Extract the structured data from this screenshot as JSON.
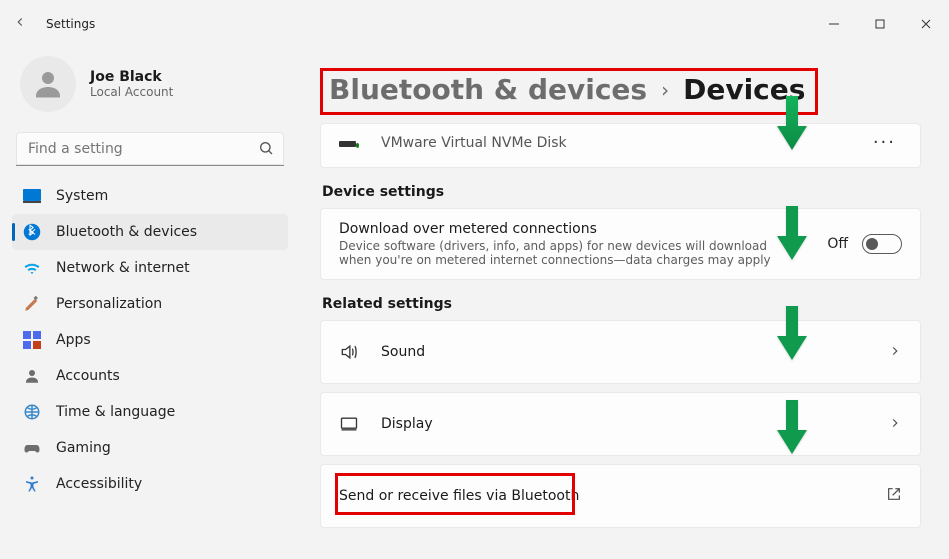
{
  "window": {
    "title": "Settings"
  },
  "user": {
    "name": "Joe Black",
    "sub": "Local Account"
  },
  "search": {
    "placeholder": "Find a setting"
  },
  "sidebar": {
    "items": [
      {
        "label": "System"
      },
      {
        "label": "Bluetooth & devices"
      },
      {
        "label": "Network & internet"
      },
      {
        "label": "Personalization"
      },
      {
        "label": "Apps"
      },
      {
        "label": "Accounts"
      },
      {
        "label": "Time & language"
      },
      {
        "label": "Gaming"
      },
      {
        "label": "Accessibility"
      }
    ],
    "active_index": 1
  },
  "breadcrumb": {
    "parent": "Bluetooth & devices",
    "current": "Devices"
  },
  "devices": {
    "last_item": {
      "label": "VMware Virtual NVMe Disk"
    }
  },
  "device_settings": {
    "heading": "Device settings",
    "metered": {
      "title": "Download over metered connections",
      "sub": "Device software (drivers, info, and apps) for new devices will download when you're on metered internet connections—data charges may apply",
      "toggle_text": "Off",
      "toggle_on": false
    }
  },
  "related": {
    "heading": "Related settings",
    "items": [
      {
        "label": "Sound"
      },
      {
        "label": "Display"
      },
      {
        "label": "Send or receive files via Bluetooth"
      }
    ]
  }
}
